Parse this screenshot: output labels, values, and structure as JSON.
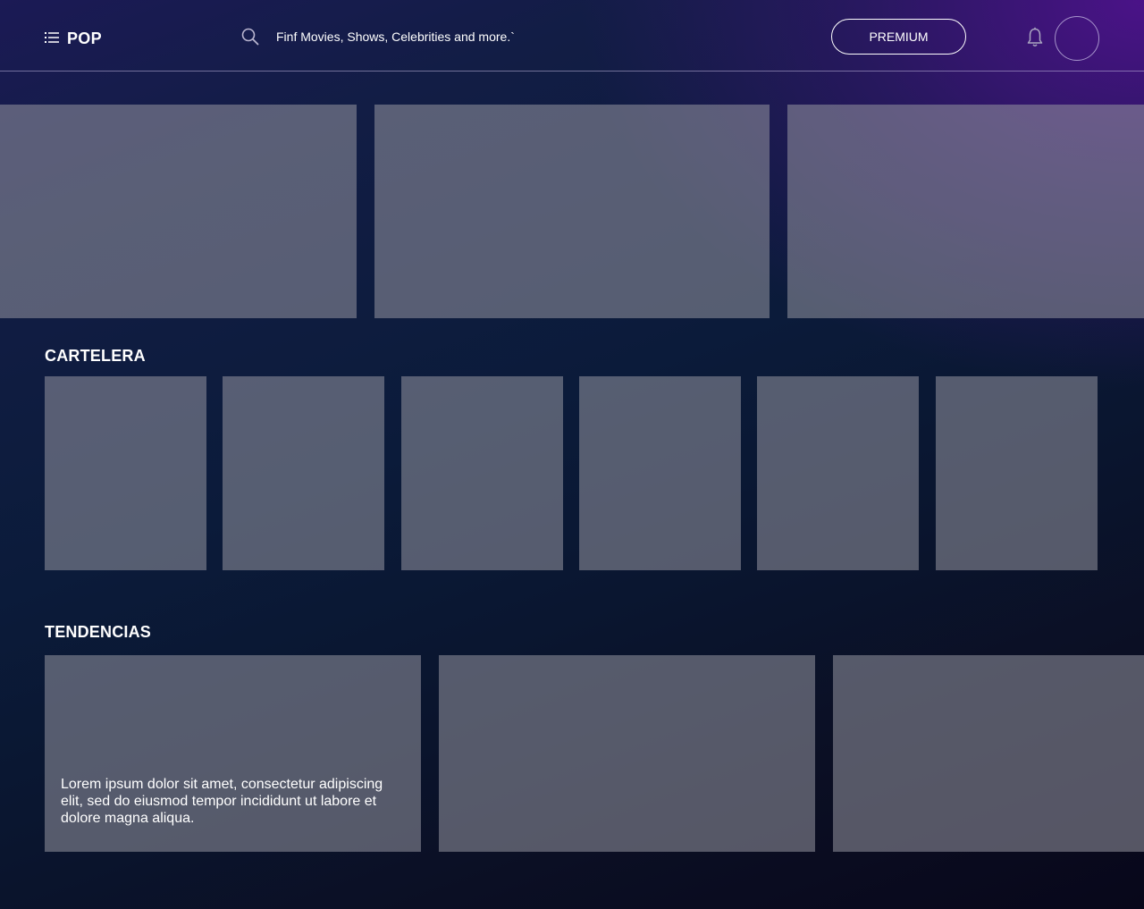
{
  "header": {
    "brand": "POP",
    "search_placeholder": "Finf Movies, Shows, Celebrities and more.`",
    "premium_label": "PREMIUM",
    "icons": {
      "menu": "list-menu-icon",
      "search": "search-icon",
      "notifications": "bell-icon"
    }
  },
  "sections": {
    "cartelera": {
      "title": "CARTELERA"
    },
    "tendencias": {
      "title": "TENDENCIAS",
      "cards": [
        {
          "description": "Lorem ipsum dolor sit amet, consectetur adipiscing elit, sed do eiusmod tempor incididunt ut labore et dolore magna aliqua."
        },
        {
          "description": ""
        },
        {
          "description": ""
        }
      ]
    }
  },
  "colors": {
    "accent_purple": "#4e128c",
    "background_dark": "#08071a",
    "card_fill": "#96969f"
  }
}
